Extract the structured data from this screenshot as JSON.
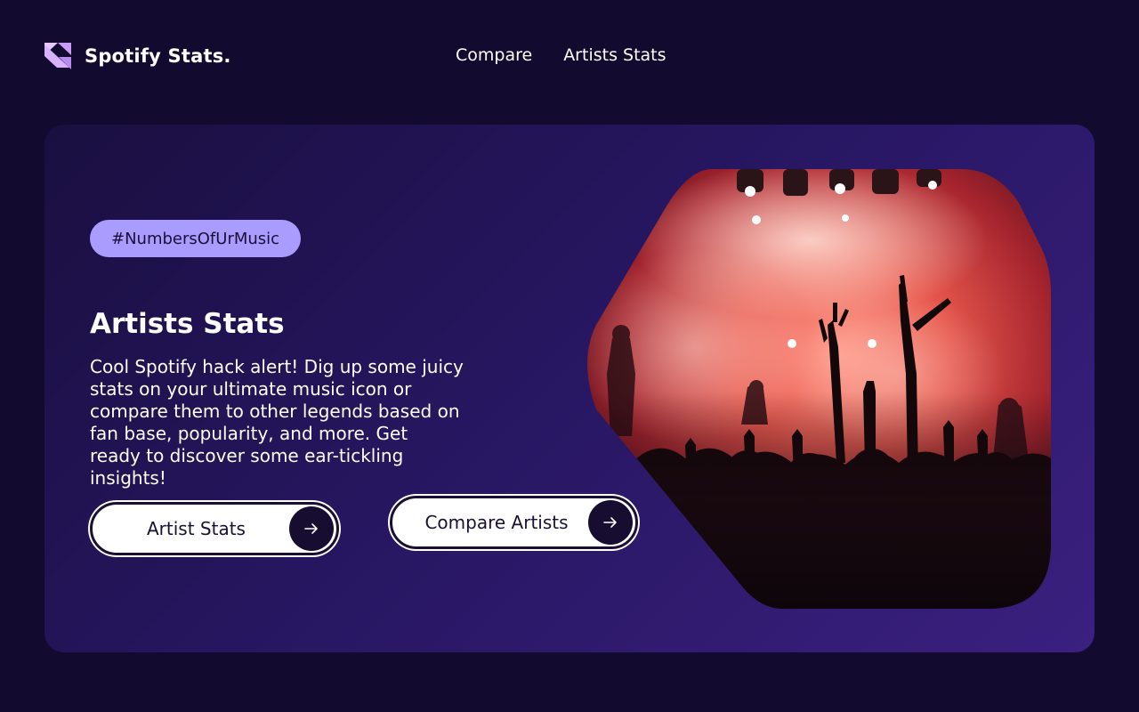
{
  "brand": {
    "name": "Spotify Stats.",
    "logo_icon": "triangles-logo-icon"
  },
  "nav": {
    "items": [
      "Compare",
      "Artists Stats"
    ]
  },
  "hero": {
    "tag": "#NumbersOfUrMusic",
    "title": "Artists Stats",
    "description": "Cool Spotify hack alert! Dig up some juicy stats on your ultimate music icon or compare them to other legends based on fan base, popularity, and more. Get ready to discover some ear-tickling insights!",
    "buttons": [
      {
        "label": "Artist Stats",
        "icon": "arrow-right-icon"
      },
      {
        "label": "Compare Artists",
        "icon": "arrow-right-icon"
      }
    ],
    "image": "concert-crowd-image"
  },
  "colors": {
    "background": "#130a30",
    "card_start": "#1a0f40",
    "card_end": "#3a2080",
    "tag_bg": "#a99bff",
    "logo_accent": "#d9b8ff",
    "button_bg": "#ffffff",
    "button_arrow_bg": "#170d30"
  }
}
